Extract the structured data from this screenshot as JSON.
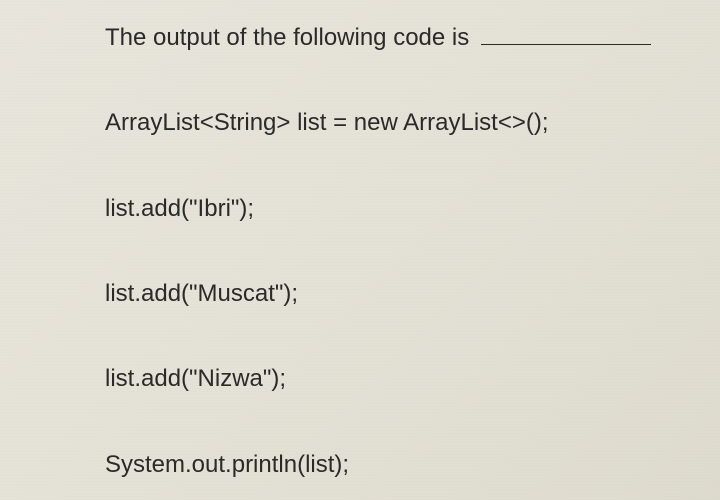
{
  "question": {
    "prompt_text": "The output of the following code is",
    "blank_placeholder": ""
  },
  "code_lines": [
    "ArrayList<String> list = new ArrayList<>();",
    "list.add(\"Ibri\");",
    "list.add(\"Muscat\");",
    "list.add(\"Nizwa\");",
    "System.out.println(list);"
  ]
}
